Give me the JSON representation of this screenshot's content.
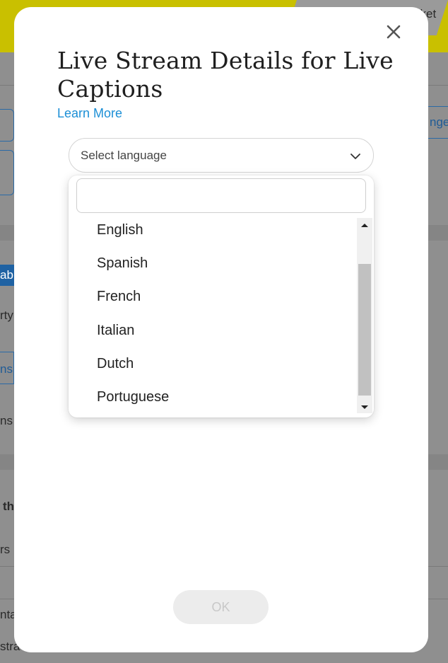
{
  "background": {
    "top_right_text": "cket",
    "left_fragments": [
      "nge",
      "ab",
      "rty",
      "ns",
      "ns",
      "th",
      "rs",
      "nta",
      "stra"
    ]
  },
  "modal": {
    "title": "Live Stream Details for Live Captions",
    "learn_more": "Learn More",
    "language_select": {
      "placeholder": "Select language",
      "search_value": "",
      "options": [
        "English",
        "Spanish",
        "French",
        "Italian",
        "Dutch",
        "Portuguese"
      ]
    },
    "ok_button": "OK"
  },
  "colors": {
    "accent_link": "#1c8fd6",
    "background_banner": "#c9c000",
    "ok_disabled_bg": "#ececec"
  }
}
